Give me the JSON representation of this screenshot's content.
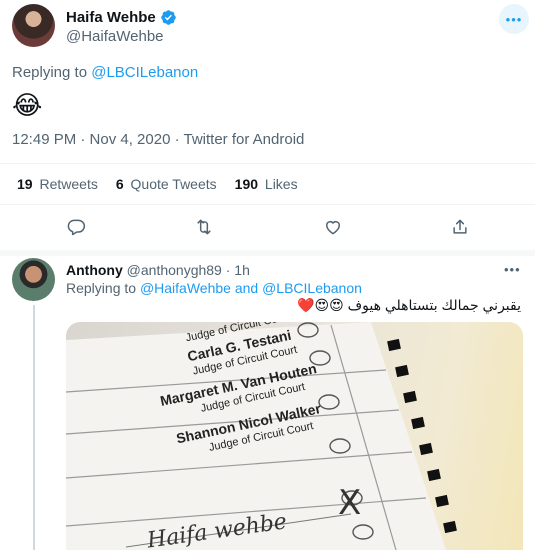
{
  "tweet": {
    "author_name": "Haifa Wehbe",
    "author_handle": "@HaifaWehbe",
    "more_label": "•••",
    "replying_prefix": "Replying to",
    "replying_to": "@LBCILebanon",
    "body_emoji": "😂",
    "timestamp": "12:49 PM · Nov 4, 2020 · Twitter for Android",
    "stats": {
      "retweets_count": "19",
      "retweets_label": "Retweets",
      "quotes_count": "6",
      "quotes_label": "Quote Tweets",
      "likes_count": "190",
      "likes_label": "Likes"
    },
    "actions": [
      "reply-icon",
      "retweet-icon",
      "like-icon",
      "share-icon"
    ]
  },
  "reply": {
    "author_name": "Anthony",
    "author_handle": "@anthonygh89",
    "time": "· 1h",
    "more_label": "•••",
    "replying_prefix": "Replying to",
    "replying_to_1": "@HaifaWehbe",
    "replying_and": "and",
    "replying_to_2": "@LBCILebanon",
    "body": "يقبرني جمالك بتستاهلي هيوف 😍😍❤️",
    "media": {
      "names": [
        "Carla G. Testani",
        "Margaret M. Van Houten",
        "Shannon Nicol Walker"
      ],
      "subtitle": "Judge of Circuit Court",
      "handwriting": "Haifa wehbe",
      "mark": "X"
    }
  },
  "colors": {
    "accent": "#1d9bf0",
    "text": "#0f1419",
    "muted": "#536471",
    "divider": "#eff3f4"
  }
}
